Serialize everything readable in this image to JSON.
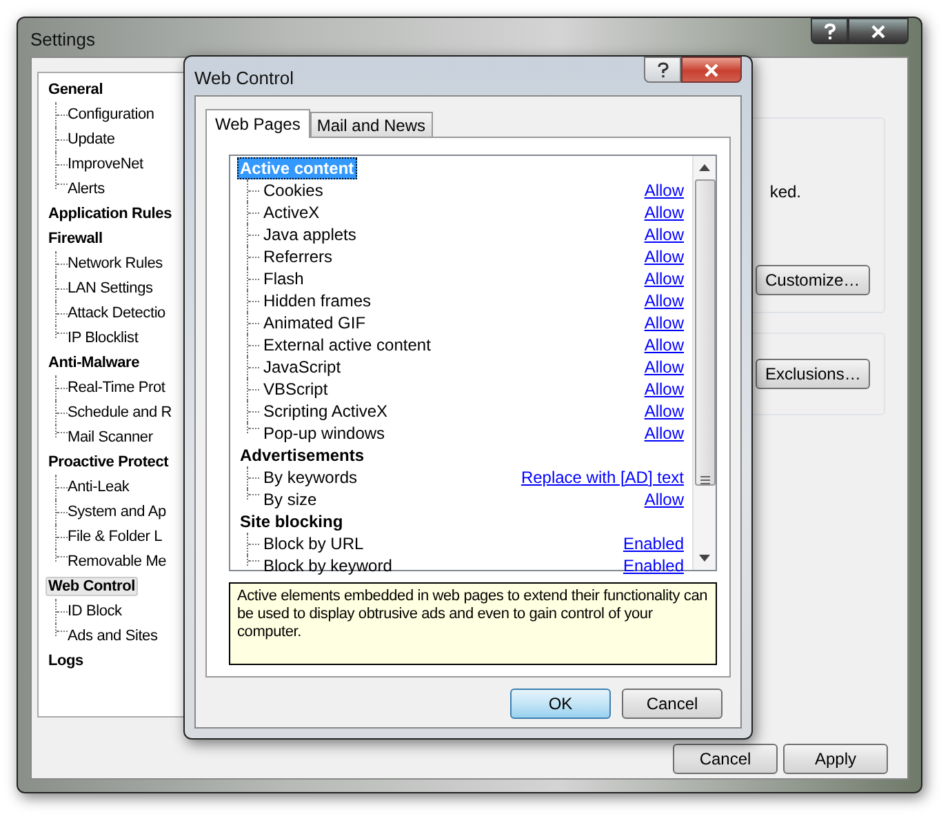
{
  "settings_window": {
    "title": "Settings",
    "tree": [
      {
        "label": "General",
        "selected": false,
        "children": [
          "Configuration",
          "Update",
          "ImproveNet",
          "Alerts"
        ]
      },
      {
        "label": "Application Rules",
        "selected": false
      },
      {
        "label": "Firewall",
        "selected": false,
        "children": [
          "Network Rules",
          "LAN Settings",
          "Attack Detectio",
          "IP Blocklist"
        ]
      },
      {
        "label": "Anti-Malware",
        "selected": false,
        "children": [
          "Real-Time Prot",
          "Schedule and R",
          "Mail Scanner"
        ]
      },
      {
        "label": "Proactive Protect",
        "selected": false,
        "children": [
          "Anti-Leak",
          "System and Ap",
          "File & Folder L",
          "Removable Me"
        ]
      },
      {
        "label": "Web Control",
        "selected": true,
        "children": [
          "ID Block",
          "Ads and Sites"
        ]
      },
      {
        "label": "Logs",
        "selected": false
      }
    ],
    "text_fragment": "ked.",
    "group_buttons": [
      "Customize…",
      "Exclusions…"
    ],
    "footer_buttons": [
      "Cancel",
      "Apply"
    ]
  },
  "dialog": {
    "title": "Web Control",
    "tabs": [
      {
        "label": "Web Pages",
        "selected": true
      },
      {
        "label": "Mail and News",
        "selected": false
      }
    ],
    "groups": [
      {
        "label": "Active content",
        "selected": true,
        "items": [
          {
            "label": "Cookies",
            "value": "Allow"
          },
          {
            "label": "ActiveX",
            "value": "Allow"
          },
          {
            "label": "Java applets",
            "value": "Allow"
          },
          {
            "label": "Referrers",
            "value": "Allow"
          },
          {
            "label": "Flash",
            "value": "Allow"
          },
          {
            "label": "Hidden frames",
            "value": "Allow"
          },
          {
            "label": "Animated GIF",
            "value": "Allow"
          },
          {
            "label": "External active content",
            "value": "Allow"
          },
          {
            "label": "JavaScript",
            "value": "Allow"
          },
          {
            "label": "VBScript",
            "value": "Allow"
          },
          {
            "label": "Scripting ActiveX",
            "value": "Allow"
          },
          {
            "label": "Pop-up windows",
            "value": "Allow"
          }
        ]
      },
      {
        "label": "Advertisements",
        "selected": false,
        "items": [
          {
            "label": "By keywords",
            "value": "Replace with [AD] text"
          },
          {
            "label": "By size",
            "value": "Allow"
          }
        ]
      },
      {
        "label": "Site blocking",
        "selected": false,
        "items": [
          {
            "label": "Block by URL",
            "value": "Enabled"
          },
          {
            "label": "Block by keyword",
            "value": "Enabled"
          }
        ]
      }
    ],
    "description": "Active elements embedded in web pages to extend their functionality can be used to display obtrusive ads and even to gain control of your computer.",
    "buttons": [
      {
        "label": "OK",
        "default": true
      },
      {
        "label": "Cancel",
        "default": false
      }
    ]
  }
}
